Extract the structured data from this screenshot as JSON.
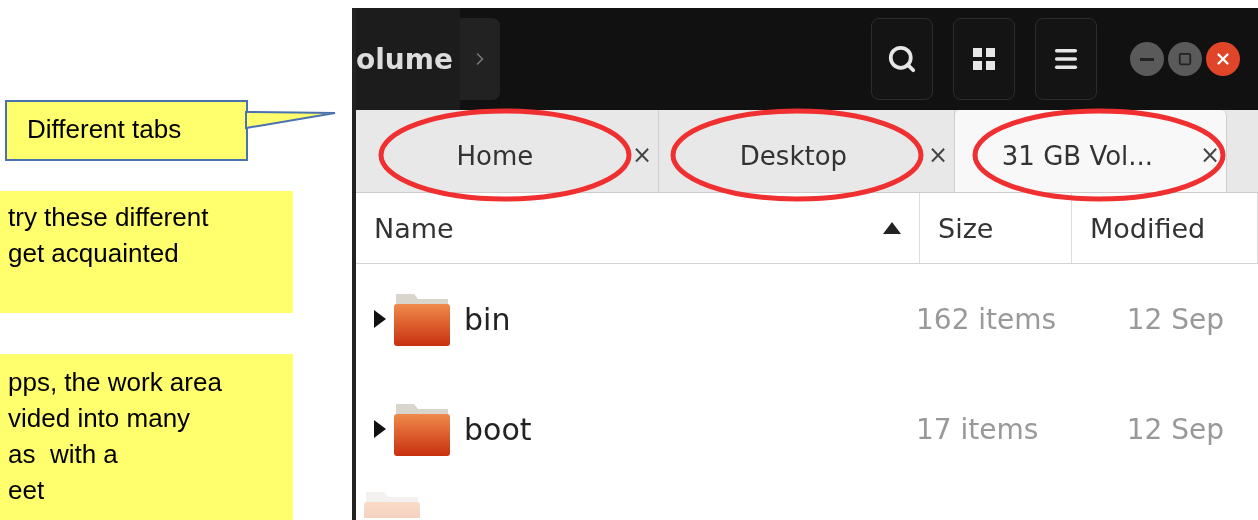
{
  "slide": {
    "callout": {
      "text": "Different tabs"
    },
    "notes": [
      {
        "lines": [
          "try these different",
          "get acquainted"
        ]
      },
      {
        "lines": [
          "pps, the work area",
          "vided into many",
          "as  with a",
          "eet"
        ]
      }
    ]
  },
  "window": {
    "title": "olume",
    "tabs": [
      {
        "label": "Home",
        "close": "×",
        "selected": false,
        "highlighted": true
      },
      {
        "label": "Desktop",
        "close": "×",
        "selected": false,
        "highlighted": true
      },
      {
        "label": "31 GB Vol...",
        "close": "×",
        "selected": true,
        "highlighted": true
      }
    ],
    "columns": [
      {
        "label": "Name",
        "sorted": true
      },
      {
        "label": "Size",
        "sorted": false
      },
      {
        "label": "Modified",
        "sorted": false
      }
    ],
    "rows": [
      {
        "name": "bin",
        "size": "162 items",
        "modified": "12 Sep",
        "expanded": false
      },
      {
        "name": "boot",
        "size": "17 items",
        "modified": "12 Sep",
        "expanded": false
      }
    ]
  }
}
